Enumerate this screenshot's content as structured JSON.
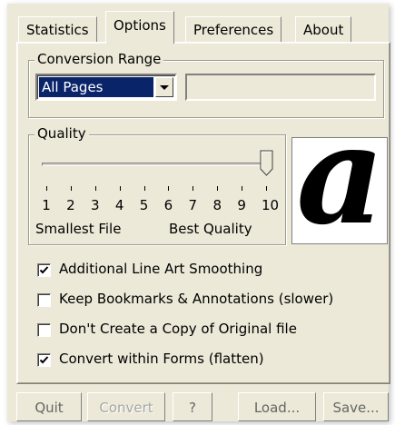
{
  "tabs": [
    {
      "label": "Statistics"
    },
    {
      "label": "Options",
      "active": true
    },
    {
      "label": "Preferences"
    },
    {
      "label": "About"
    }
  ],
  "conversion_range": {
    "legend": "Conversion Range",
    "selected": "All Pages",
    "text_value": ""
  },
  "quality": {
    "legend": "Quality",
    "level": 10,
    "min": 1,
    "max": 10,
    "ticks": [
      "1",
      "2",
      "3",
      "4",
      "5",
      "6",
      "7",
      "8",
      "9",
      "10"
    ],
    "left_label": "Smallest File",
    "right_label": "Best Quality",
    "sample_glyph": "a"
  },
  "options": [
    {
      "label": "Additional Line Art Smoothing",
      "checked": true
    },
    {
      "label": "Keep Bookmarks & Annotations (slower)",
      "checked": false
    },
    {
      "label": "Don't Create a Copy of Original file",
      "checked": false
    },
    {
      "label": "Convert within Forms (flatten)",
      "checked": true
    }
  ],
  "buttons": {
    "quit": "Quit",
    "convert": "Convert",
    "help": "?",
    "load": "Load...",
    "save": "Save..."
  },
  "colors": {
    "face": "#ece9d8",
    "selection": "#0a246a"
  }
}
